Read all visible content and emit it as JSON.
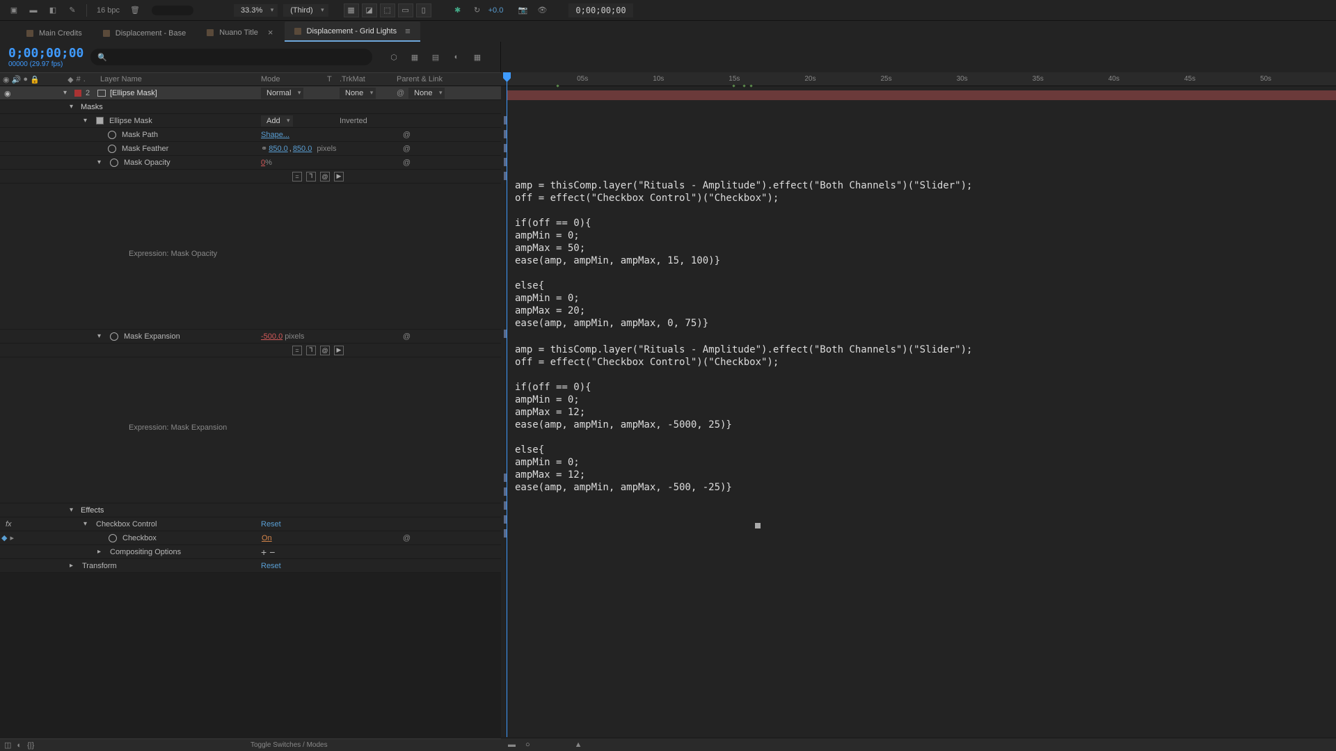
{
  "toolbar": {
    "bpc": "16 bpc",
    "zoom": "33.3%",
    "resolution": "(Third)",
    "exposure": "+0.0",
    "timecode": "0;00;00;00"
  },
  "tabs": {
    "items": [
      {
        "label": "Main Credits"
      },
      {
        "label": "Displacement - Base"
      },
      {
        "label": "Nuano Title"
      },
      {
        "label": "Displacement - Grid Lights"
      }
    ]
  },
  "timeline_header": {
    "timecode": "0;00;00;00",
    "fps": "00000 (29.97 fps)"
  },
  "columns": {
    "layer_name": "Layer Name",
    "mode": "Mode",
    "t": "T",
    "trkmat": ".TrkMat",
    "parent": "Parent & Link",
    "hash": "#"
  },
  "ruler": {
    "ticks": [
      "",
      "05s",
      "10s",
      "15s",
      "20s",
      "25s",
      "30s",
      "35s",
      "40s",
      "45s",
      "50s"
    ]
  },
  "layer": {
    "num": "2",
    "name": "[Ellipse Mask]",
    "mode": "Normal",
    "trkmat": "None",
    "parent": "None"
  },
  "masks": {
    "label": "Masks",
    "ellipse": {
      "label": "Ellipse Mask",
      "mode": "Add",
      "inverted": "Inverted"
    },
    "mask_path": {
      "label": "Mask Path",
      "value": "Shape..."
    },
    "mask_feather": {
      "label": "Mask Feather",
      "x": "850.0",
      "y": "850.0",
      "unit": "pixels"
    },
    "mask_opacity": {
      "label": "Mask Opacity",
      "value": "0",
      "unit": "%",
      "expr_label": "Expression: Mask Opacity"
    },
    "mask_expansion": {
      "label": "Mask Expansion",
      "value": "-500.0",
      "unit": "pixels",
      "expr_label": "Expression: Mask Expansion"
    }
  },
  "effects": {
    "label": "Effects",
    "checkbox_control": {
      "label": "Checkbox Control",
      "reset": "Reset"
    },
    "checkbox": {
      "label": "Checkbox",
      "value": "On"
    },
    "compositing": {
      "label": "Compositing Options"
    }
  },
  "transform": {
    "label": "Transform",
    "reset": "Reset"
  },
  "bottom": {
    "toggle": "Toggle Switches / Modes"
  },
  "expression1": "amp = thisComp.layer(\"Rituals - Amplitude\").effect(\"Both Channels\")(\"Slider\");\noff = effect(\"Checkbox Control\")(\"Checkbox\");\n\nif(off == 0){\nampMin = 0;\nampMax = 50;\nease(amp, ampMin, ampMax, 15, 100)}\n\nelse{\nampMin = 0;\nampMax = 20;\nease(amp, ampMin, ampMax, 0, 75)}",
  "expression2": "amp = thisComp.layer(\"Rituals - Amplitude\").effect(\"Both Channels\")(\"Slider\");\noff = effect(\"Checkbox Control\")(\"Checkbox\");\n\nif(off == 0){\nampMin = 0;\nampMax = 12;\nease(amp, ampMin, ampMax, -5000, 25)}\n\nelse{\nampMin = 0;\nampMax = 12;\nease(amp, ampMin, ampMax, -500, -25)}"
}
